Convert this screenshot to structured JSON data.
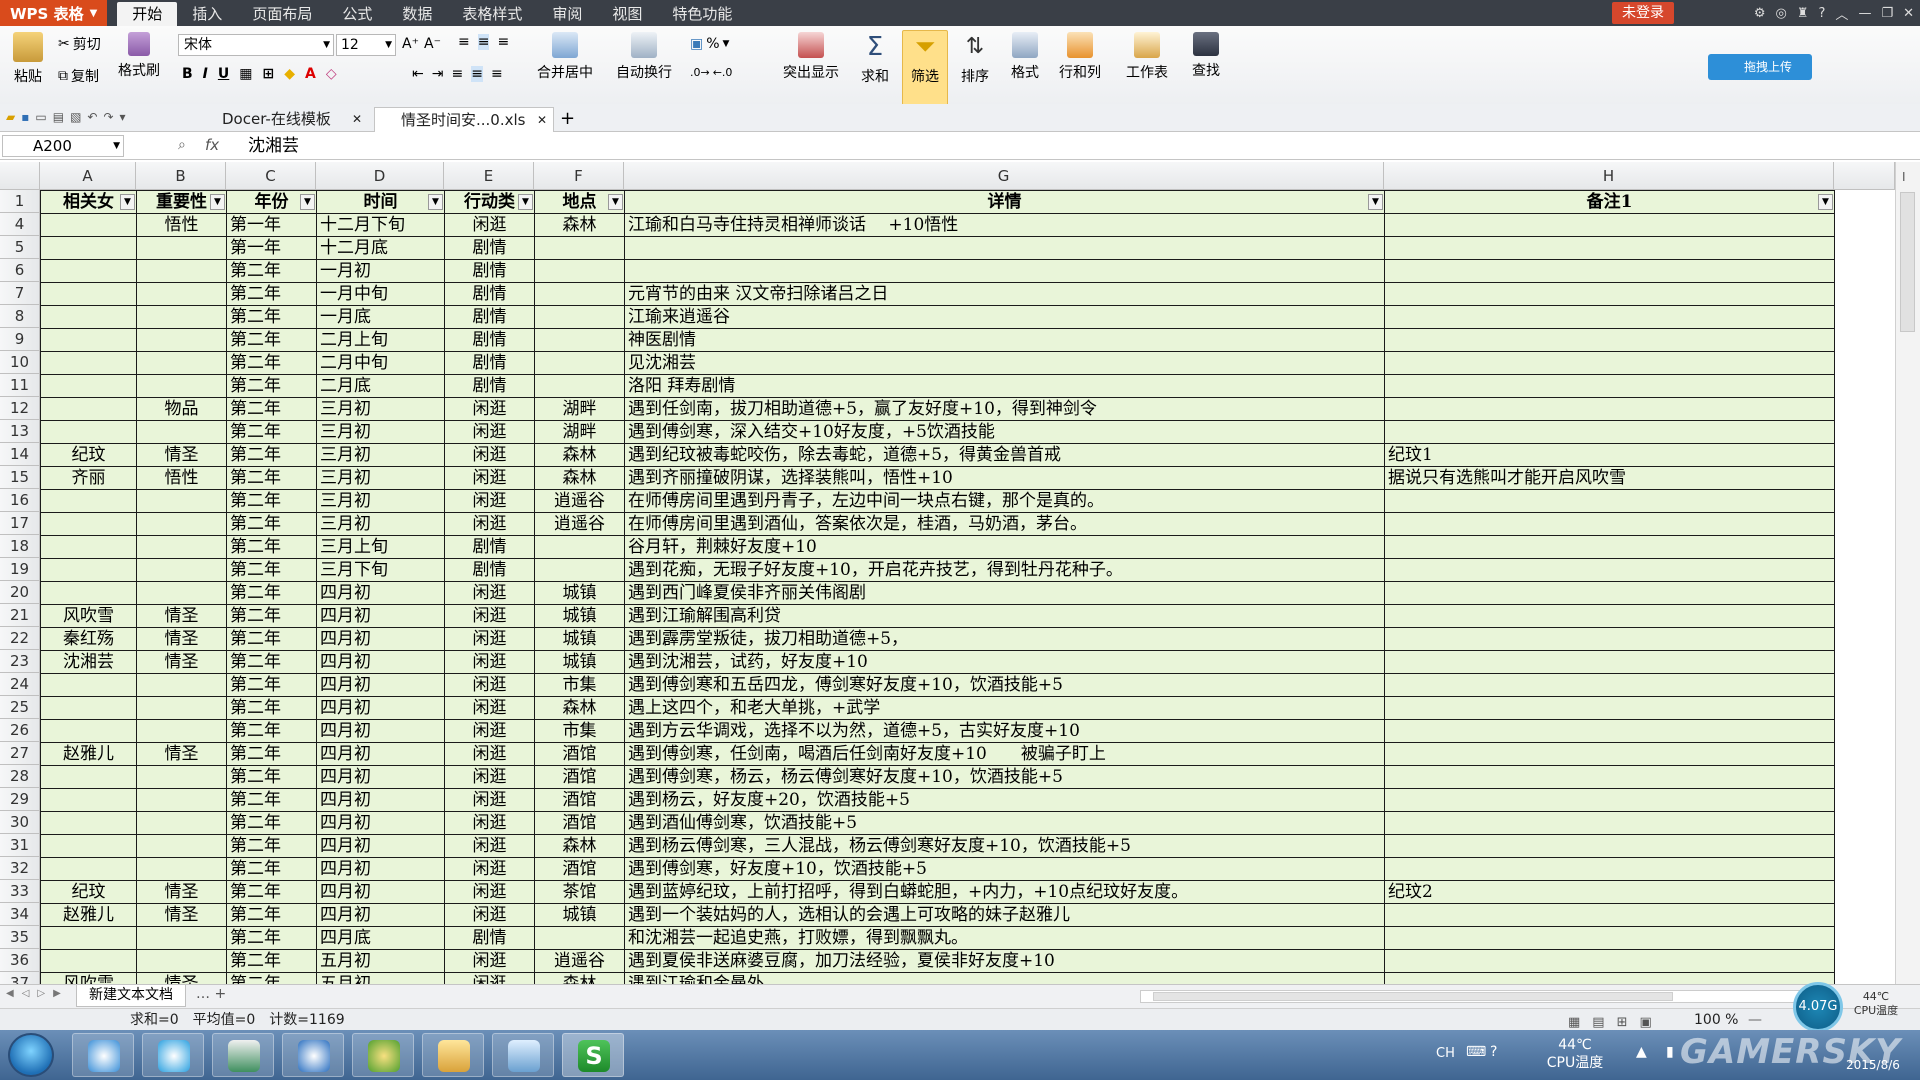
{
  "app": {
    "name": "WPS 表格"
  },
  "menu": [
    "开始",
    "插入",
    "页面布局",
    "公式",
    "数据",
    "表格样式",
    "审阅",
    "视图",
    "特色功能"
  ],
  "login_label": "未登录",
  "ribbon": {
    "paste": "粘贴",
    "cut": "剪切",
    "copy": "复制",
    "format_painter": "格式刷",
    "font": "宋体",
    "font_size": "12",
    "merge": "合并居中",
    "wrap": "自动换行",
    "highlight": "突出显示",
    "sum": "求和",
    "filter": "筛选",
    "sort": "排序",
    "format": "格式",
    "rowcol": "行和列",
    "worksheet": "工作表",
    "find": "查找",
    "percent": "%",
    "upload": "拖拽上传"
  },
  "doc_tabs": [
    {
      "label": "Docer-在线模板"
    },
    {
      "label": "情圣时间安...0.xls"
    }
  ],
  "formula": {
    "cell_ref": "A200",
    "fx": "fx",
    "value": "沈湘芸"
  },
  "columns": [
    "A",
    "B",
    "C",
    "D",
    "E",
    "F",
    "G",
    "H"
  ],
  "header": [
    "相关女",
    "重要性",
    "年份",
    "时间",
    "行动类",
    "地点",
    "详情",
    "备注1"
  ],
  "rows": [
    {
      "n": "4",
      "c": [
        "",
        "悟性",
        "第一年",
        "十二月下旬",
        "闲逛",
        "森林",
        "江瑜和白马寺住持灵相禅师谈话　 +10悟性",
        ""
      ]
    },
    {
      "n": "5",
      "c": [
        "",
        "",
        "第一年",
        "十二月底",
        "剧情",
        "",
        "",
        ""
      ]
    },
    {
      "n": "6",
      "c": [
        "",
        "",
        "第二年",
        "一月初",
        "剧情",
        "",
        "",
        ""
      ]
    },
    {
      "n": "7",
      "c": [
        "",
        "",
        "第二年",
        "一月中旬",
        "剧情",
        "",
        "元宵节的由来 汉文帝扫除诸吕之日",
        ""
      ]
    },
    {
      "n": "8",
      "c": [
        "",
        "",
        "第二年",
        "一月底",
        "剧情",
        "",
        "江瑜来逍遥谷",
        ""
      ]
    },
    {
      "n": "9",
      "c": [
        "",
        "",
        "第二年",
        "二月上旬",
        "剧情",
        "",
        "神医剧情",
        ""
      ]
    },
    {
      "n": "10",
      "c": [
        "",
        "",
        "第二年",
        "二月中旬",
        "剧情",
        "",
        "见沈湘芸",
        ""
      ]
    },
    {
      "n": "11",
      "c": [
        "",
        "",
        "第二年",
        "二月底",
        "剧情",
        "",
        "洛阳 拜寿剧情",
        ""
      ]
    },
    {
      "n": "12",
      "c": [
        "",
        "物品",
        "第二年",
        "三月初",
        "闲逛",
        "湖畔",
        "遇到任剑南，拔刀相助道德+5，赢了友好度+10，得到神剑令",
        ""
      ]
    },
    {
      "n": "13",
      "c": [
        "",
        "",
        "第二年",
        "三月初",
        "闲逛",
        "湖畔",
        "遇到傅剑寒，深入结交+10好友度，+5饮酒技能",
        ""
      ]
    },
    {
      "n": "14",
      "c": [
        "纪玟",
        "情圣",
        "第二年",
        "三月初",
        "闲逛",
        "森林",
        "遇到纪玟被毒蛇咬伤，除去毒蛇，道德+5，得黄金兽首戒",
        "纪玟1"
      ]
    },
    {
      "n": "15",
      "c": [
        "齐丽",
        "悟性",
        "第二年",
        "三月初",
        "闲逛",
        "森林",
        "遇到齐丽撞破阴谋，选择装熊叫，悟性+10",
        "据说只有选熊叫才能开启风吹雪"
      ]
    },
    {
      "n": "16",
      "c": [
        "",
        "",
        "第二年",
        "三月初",
        "闲逛",
        "逍遥谷",
        "在师傅房间里遇到丹青子，左边中间一块点右键，那个是真的。",
        ""
      ]
    },
    {
      "n": "17",
      "c": [
        "",
        "",
        "第二年",
        "三月初",
        "闲逛",
        "逍遥谷",
        "在师傅房间里遇到酒仙，答案依次是，桂酒，马奶酒，茅台。",
        ""
      ]
    },
    {
      "n": "18",
      "c": [
        "",
        "",
        "第二年",
        "三月上旬",
        "剧情",
        "",
        "谷月轩，荆棘好友度+10",
        ""
      ]
    },
    {
      "n": "19",
      "c": [
        "",
        "",
        "第二年",
        "三月下旬",
        "剧情",
        "",
        "遇到花痴，无瑕子好友度+10，开启花卉技艺，得到牡丹花种子。",
        ""
      ]
    },
    {
      "n": "20",
      "c": [
        "",
        "",
        "第二年",
        "四月初",
        "闲逛",
        "城镇",
        "遇到西门峰夏侯非齐丽关伟阁剧",
        ""
      ]
    },
    {
      "n": "21",
      "c": [
        "风吹雪",
        "情圣",
        "第二年",
        "四月初",
        "闲逛",
        "城镇",
        "遇到江瑜解围高利贷",
        ""
      ]
    },
    {
      "n": "22",
      "c": [
        "秦红殇",
        "情圣",
        "第二年",
        "四月初",
        "闲逛",
        "城镇",
        "遇到霹雳堂叛徒，拔刀相助道德+5，",
        ""
      ]
    },
    {
      "n": "23",
      "c": [
        "沈湘芸",
        "情圣",
        "第二年",
        "四月初",
        "闲逛",
        "城镇",
        "遇到沈湘芸，试药，好友度+10",
        ""
      ]
    },
    {
      "n": "24",
      "c": [
        "",
        "",
        "第二年",
        "四月初",
        "闲逛",
        "市集",
        "遇到傅剑寒和五岳四龙，傅剑寒好友度+10，饮酒技能+5",
        ""
      ]
    },
    {
      "n": "25",
      "c": [
        "",
        "",
        "第二年",
        "四月初",
        "闲逛",
        "森林",
        "遇上这四个，和老大单挑，+武学",
        ""
      ]
    },
    {
      "n": "26",
      "c": [
        "",
        "",
        "第二年",
        "四月初",
        "闲逛",
        "市集",
        "遇到方云华调戏，选择不以为然，道德+5，古实好友度+10",
        ""
      ]
    },
    {
      "n": "27",
      "c": [
        "赵雅儿",
        "情圣",
        "第二年",
        "四月初",
        "闲逛",
        "酒馆",
        "遇到傅剑寒，任剑南，喝酒后任剑南好友度+10　　被骗子盯上",
        ""
      ]
    },
    {
      "n": "28",
      "c": [
        "",
        "",
        "第二年",
        "四月初",
        "闲逛",
        "酒馆",
        "遇到傅剑寒，杨云，杨云傅剑寒好友度+10，饮酒技能+5",
        ""
      ]
    },
    {
      "n": "29",
      "c": [
        "",
        "",
        "第二年",
        "四月初",
        "闲逛",
        "酒馆",
        "遇到杨云，好友度+20，饮酒技能+5",
        ""
      ]
    },
    {
      "n": "30",
      "c": [
        "",
        "",
        "第二年",
        "四月初",
        "闲逛",
        "酒馆",
        "遇到酒仙傅剑寒，饮酒技能+5",
        ""
      ]
    },
    {
      "n": "31",
      "c": [
        "",
        "",
        "第二年",
        "四月初",
        "闲逛",
        "森林",
        "遇到杨云傅剑寒，三人混战，杨云傅剑寒好友度+10，饮酒技能+5",
        ""
      ]
    },
    {
      "n": "32",
      "c": [
        "",
        "",
        "第二年",
        "四月初",
        "闲逛",
        "酒馆",
        "遇到傅剑寒，好友度+10，饮酒技能+5",
        ""
      ]
    },
    {
      "n": "33",
      "c": [
        "纪玟",
        "情圣",
        "第二年",
        "四月初",
        "闲逛",
        "茶馆",
        "遇到蓝婷纪玟，上前打招呼，得到白蟒蛇胆，+内力，+10点纪玟好友度。",
        "纪玟2"
      ]
    },
    {
      "n": "34",
      "c": [
        "赵雅儿",
        "情圣",
        "第二年",
        "四月初",
        "闲逛",
        "城镇",
        "遇到一个装姑妈的人，选相认的会遇上可攻略的妹子赵雅儿",
        ""
      ]
    },
    {
      "n": "35",
      "c": [
        "",
        "",
        "第二年",
        "四月底",
        "剧情",
        "",
        "和沈湘芸一起追史燕，打败嫖，得到飘飘丸。",
        ""
      ]
    },
    {
      "n": "36",
      "c": [
        "",
        "",
        "第二年",
        "五月初",
        "闲逛",
        "逍遥谷",
        "遇到夏侯非送麻婆豆腐，加刀法经验，夏侯非好友度+10",
        ""
      ]
    },
    {
      "n": "37",
      "c": [
        "风吹雪",
        "情圣",
        "第二年",
        "五月初",
        "闲逛",
        "森林",
        "遇到江瑜和金曼外",
        ""
      ]
    }
  ],
  "sheet_tab": "新建文本文档",
  "status": "求和=0　平均值=0　计数=1169",
  "zoom": "100 %",
  "cpu": {
    "usage": "4.07G",
    "temp": "44℃",
    "label": "CPU温度"
  },
  "tray": {
    "lang": "CH",
    "temp": "44℃",
    "label": "CPU温度",
    "date": "2015/8/6"
  },
  "watermark": "GAMERSKY"
}
